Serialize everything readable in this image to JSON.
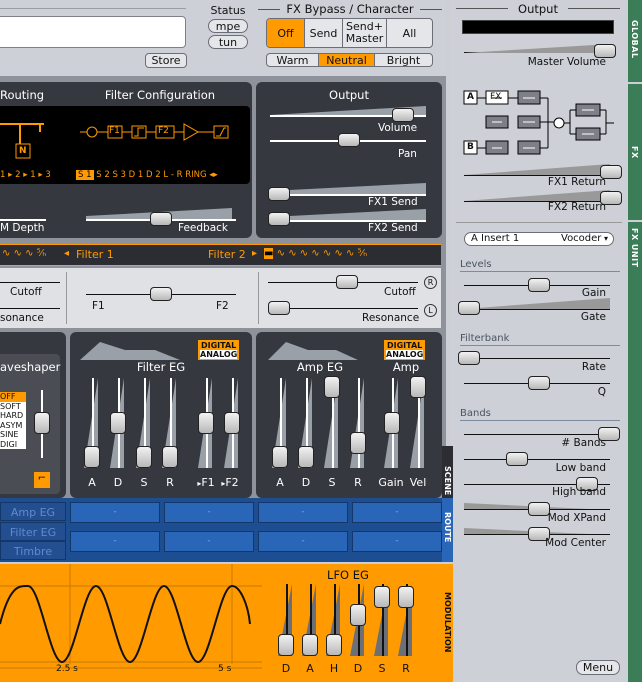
{
  "top": {
    "store_label": "Store",
    "status_title": "Status",
    "mpe_label": "mpe",
    "tun_label": "tun",
    "fx_bypass_title": "FX Bypass / Character",
    "bypass_options": [
      "Off",
      "Send",
      "Send+ Master",
      "All"
    ],
    "bypass_selected": "Off",
    "character_options": [
      "Warm",
      "Neutral",
      "Bright"
    ],
    "character_selected": "Neutral"
  },
  "right": {
    "output_title": "Output",
    "master_volume_label": "Master Volume",
    "fx_routing": {
      "a_label": "A",
      "b_label": "B",
      "fx_label": "FX"
    },
    "fx1_return_label": "FX1 Return",
    "fx2_return_label": "FX2 Return",
    "fx_unit_selector": "A Insert 1",
    "fx_type_selector": "Vocoder",
    "sections": {
      "levels": "Levels",
      "filterbank": "Filterbank",
      "bands": "Bands"
    },
    "params": {
      "gain": "Gain",
      "gate": "Gate",
      "rate": "Rate",
      "q": "Q",
      "bands": "# Bands",
      "low_band": "Low band",
      "high_band": "High band",
      "mod_xpand": "Mod XPand",
      "mod_center": "Mod Center"
    },
    "menu_label": "Menu",
    "strip_labels": {
      "global": "GLOBAL",
      "fx": "FX",
      "fx_unit": "FX UNIT"
    }
  },
  "scene": {
    "routing_title": "Routing",
    "filter_config_title": "Filter Configuration",
    "output_title": "Output",
    "output_params": [
      "Volume",
      "Pan",
      "FX1 Send",
      "FX2 Send"
    ],
    "filter_config_params": {
      "n_label": "N",
      "chain": [
        "F1",
        "F2"
      ],
      "feedback": "Feedback",
      "fm_depth": "M Depth"
    },
    "routing_modes": [
      "1",
      "2",
      "1",
      "3"
    ],
    "filter_modes": [
      "S 1",
      "S 2",
      "S 3",
      "D 1",
      "D 2",
      "L - R",
      "RING"
    ],
    "filter_mode_selected": "S 1",
    "filter1_label": "Filter 1",
    "filter2_label": "Filter 2",
    "cutoff_label": "Cutoff",
    "resonance_label_left": "sonance",
    "resonance_label_right": "Resonance",
    "balance_f1": "F1",
    "balance_f2": "F2",
    "waveshaper_title": "aveshaper",
    "waveshaper_types": [
      "OFF",
      "SOFT",
      "HARD",
      "ASYM",
      "SINE",
      "DIGI"
    ],
    "waveshaper_selected": "OFF",
    "filter_eg_title": "Filter EG",
    "amp_eg_title": "Amp EG",
    "amp_title": "Amp",
    "digital_label": "DIGITAL",
    "analog_label": "ANALOG",
    "filter_eg_labels": [
      "A",
      "D",
      "S",
      "R",
      "F1",
      "F2"
    ],
    "amp_eg_labels": [
      "A",
      "D",
      "S",
      "R",
      "Gain",
      "Vel"
    ],
    "side_label": "SCENE"
  },
  "route": {
    "rows": [
      {
        "label": "Amp EG",
        "cells": [
          "-",
          "-",
          "-",
          "-"
        ]
      },
      {
        "label": "Filter EG",
        "cells": [
          "-",
          "-",
          "-",
          "-"
        ]
      },
      {
        "label": "Timbre",
        "cells": [
          "-",
          "-",
          "-",
          "-"
        ]
      }
    ],
    "side_label": "ROUTE"
  },
  "modulation": {
    "time_ticks": [
      "2.5 s",
      "5 s"
    ],
    "lfo_eg_title": "LFO EG",
    "lfo_eg_labels": [
      "D",
      "A",
      "H",
      "D",
      "S",
      "R"
    ],
    "side_label": "MODULATION"
  },
  "colors": {
    "accent": "#ff9a00",
    "panel_dark": "#35383e",
    "route_blue": "#1e4e92",
    "strip_green": "#3a7d56"
  }
}
